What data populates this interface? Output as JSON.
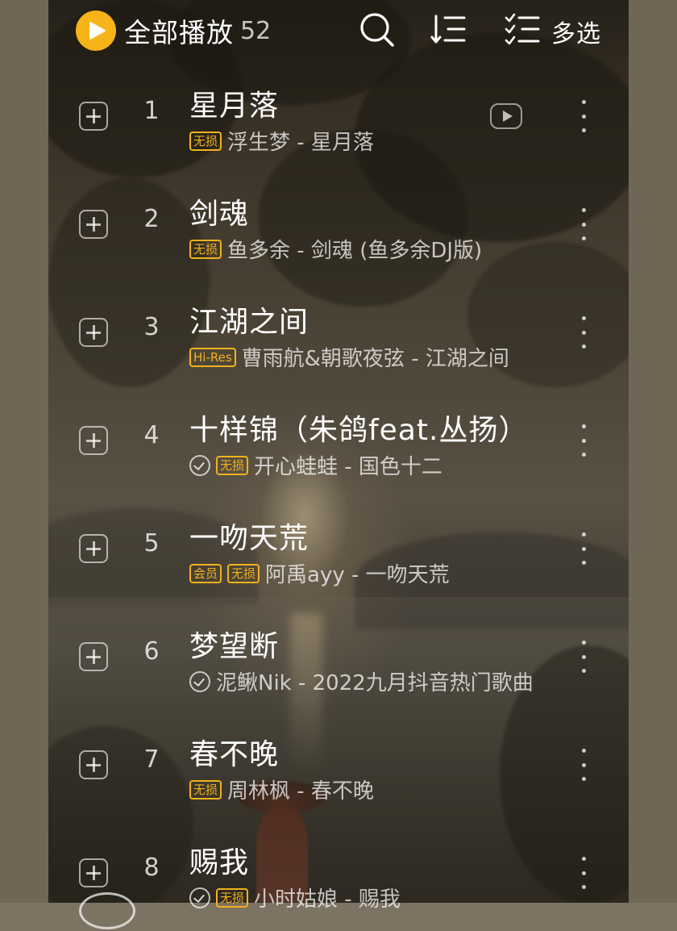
{
  "header": {
    "play_all_label": "全部播放",
    "play_all_count": "52",
    "multi_select_label": "多选",
    "accent_color": "#f7b418"
  },
  "songs": [
    {
      "index": "1",
      "title": "星月落",
      "badges": [
        "无损"
      ],
      "subtitle": "浮生梦 - 星月落",
      "downloaded": false,
      "has_mv": true
    },
    {
      "index": "2",
      "title": "剑魂",
      "badges": [
        "无损"
      ],
      "subtitle": "鱼多余 - 剑魂 (鱼多余DJ版)",
      "downloaded": false,
      "has_mv": false
    },
    {
      "index": "3",
      "title": "江湖之间",
      "badges": [
        "Hi-Res"
      ],
      "subtitle": "曹雨航&朝歌夜弦 - 江湖之间",
      "downloaded": false,
      "has_mv": false
    },
    {
      "index": "4",
      "title": "十样锦（朱鸽feat.丛扬）",
      "badges": [
        "无损"
      ],
      "subtitle": "开心蛙蛙 - 国色十二",
      "downloaded": true,
      "has_mv": false
    },
    {
      "index": "5",
      "title": "一吻天荒",
      "badges": [
        "会员",
        "无损"
      ],
      "subtitle": "阿禹ayy - 一吻天荒",
      "downloaded": false,
      "has_mv": false
    },
    {
      "index": "6",
      "title": "梦望断",
      "badges": [],
      "subtitle": "泥鳅Nik - 2022九月抖音热门歌曲",
      "downloaded": true,
      "has_mv": false
    },
    {
      "index": "7",
      "title": "春不晚",
      "badges": [
        "无损"
      ],
      "subtitle": "周林枫 - 春不晚",
      "downloaded": false,
      "has_mv": false
    },
    {
      "index": "8",
      "title": "赐我",
      "badges": [
        "无损"
      ],
      "subtitle": "小时姑娘 - 赐我",
      "downloaded": true,
      "has_mv": false
    }
  ],
  "icons": {
    "search": "search-icon",
    "sort": "sort-icon",
    "multi_select": "multi-select-icon",
    "add": "add-to-playlist-icon",
    "more": "more-vertical-icon",
    "mv": "mv-play-icon",
    "downloaded": "downloaded-check-icon"
  }
}
